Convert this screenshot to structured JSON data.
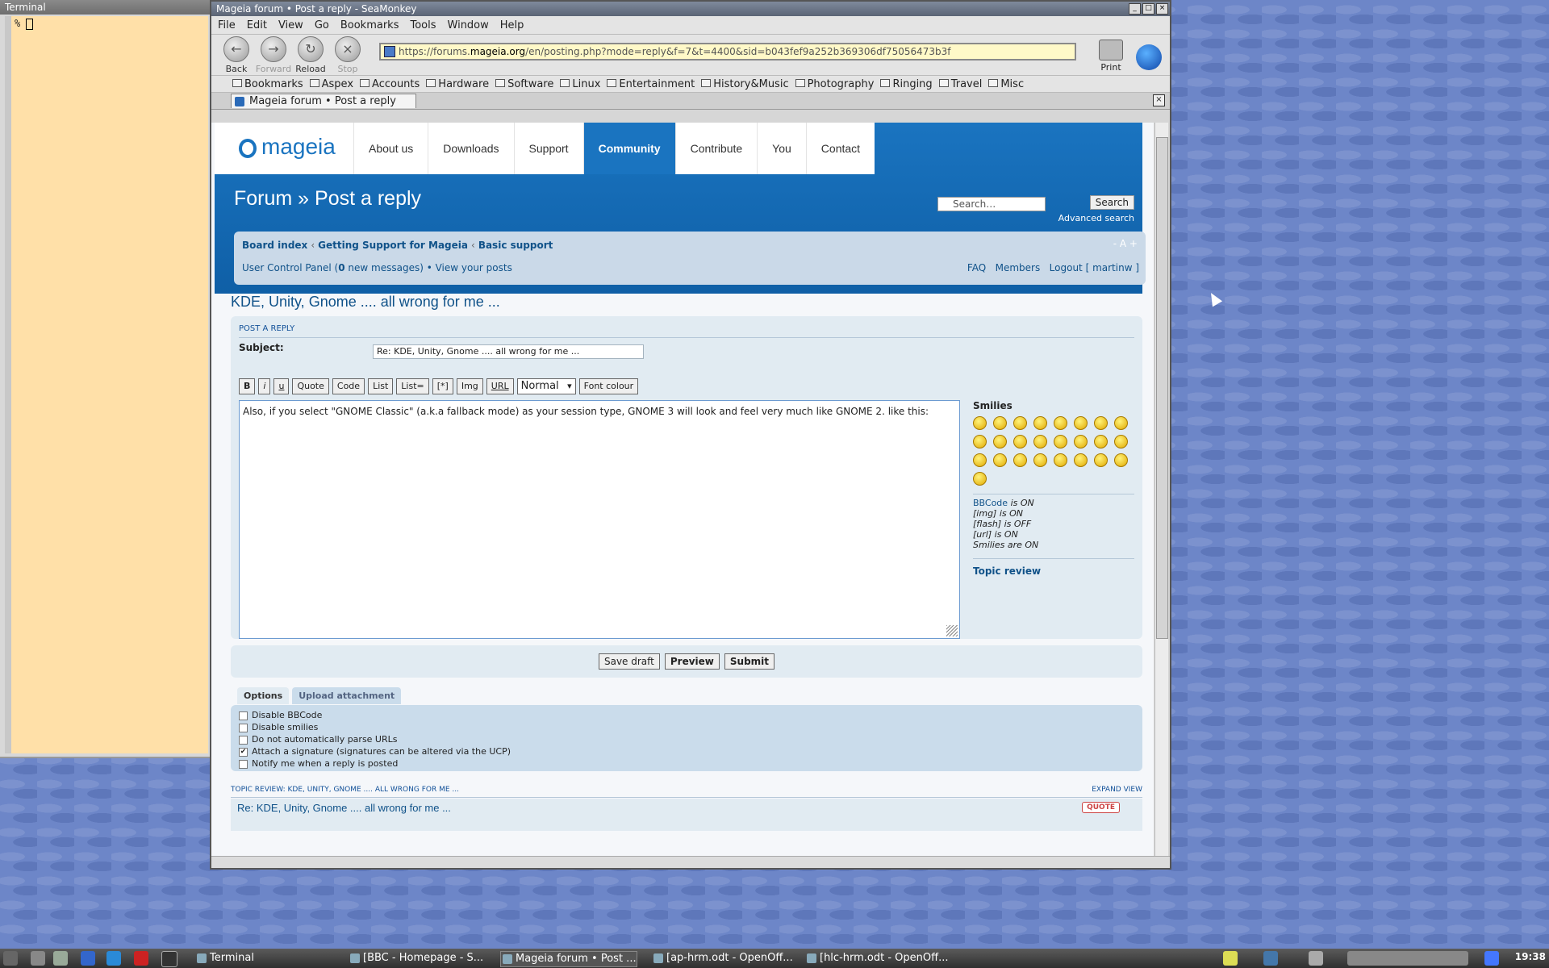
{
  "terminal": {
    "title": "Terminal",
    "prompt": "%"
  },
  "window": {
    "title": "Mageia forum • Post a reply - SeaMonkey"
  },
  "menubar": [
    "File",
    "Edit",
    "View",
    "Go",
    "Bookmarks",
    "Tools",
    "Window",
    "Help"
  ],
  "nav": {
    "back": "Back",
    "forward": "Forward",
    "reload": "Reload",
    "stop": "Stop",
    "print": "Print"
  },
  "url": {
    "prefix": "https://forums.",
    "domain": "mageia.org",
    "suffix": "/en/posting.php?mode=reply&f=7&t=4400&sid=b043fef9a252b369306df75056473b3f"
  },
  "bookmarks": [
    "Bookmarks",
    "Aspex",
    "Accounts",
    "Hardware",
    "Software",
    "Linux",
    "Entertainment",
    "History&Music",
    "Photography",
    "Ringing",
    "Travel",
    "Misc"
  ],
  "tab": {
    "label": "Mageia forum • Post a reply"
  },
  "site": {
    "logo_text": "mageia",
    "nav": [
      "About us",
      "Downloads",
      "Support",
      "Community",
      "Contribute",
      "You",
      "Contact"
    ],
    "active_nav": "Community",
    "heading": "Forum » Post a reply",
    "search_placeholder": "Search…",
    "search_button": "Search",
    "advanced_search": "Advanced search",
    "font_size": "- A +"
  },
  "breadcrumbs": {
    "board_index": "Board index",
    "getting_support": "Getting Support for Mageia",
    "basic_support": "Basic support"
  },
  "userbar": {
    "ucp": "User Control Panel (",
    "new_count": "0",
    "new_messages": " new messages) • View your posts",
    "faq": "FAQ",
    "members": "Members",
    "logout": "Logout [ martinw ]"
  },
  "topic_title": "KDE, Unity, Gnome .... all wrong for me ...",
  "post": {
    "panel_title": "Post a reply",
    "subject_label": "Subject:",
    "subject_value": "Re: KDE, Unity, Gnome .... all wrong for me ...",
    "message": "Also, if you select \"GNOME Classic\" (a.k.a fallback mode) as your session type, GNOME 3 will look and feel very much like GNOME 2. like this:"
  },
  "bbcode_buttons": [
    "B",
    "i",
    "u",
    "Quote",
    "Code",
    "List",
    "List=",
    "[*]",
    "Img",
    "URL"
  ],
  "font_size_select": "Normal",
  "font_colour": "Font colour",
  "smilies": {
    "heading": "Smilies",
    "count": 25,
    "bbcode_label": "BBCode",
    "bbcode_state": "is ON",
    "img": "[img] is ON",
    "flash": "[flash] is OFF",
    "url": "[url] is ON",
    "smilies": "Smilies are ON",
    "topic_review": "Topic review"
  },
  "actions": {
    "save_draft": "Save draft",
    "preview": "Preview",
    "submit": "Submit"
  },
  "option_tabs": [
    "Options",
    "Upload attachment"
  ],
  "options": [
    {
      "label": "Disable BBCode",
      "checked": false
    },
    {
      "label": "Disable smilies",
      "checked": false
    },
    {
      "label": "Do not automatically parse URLs",
      "checked": false
    },
    {
      "label": "Attach a signature (signatures can be altered via the UCP)",
      "checked": true
    },
    {
      "label": "Notify me when a reply is posted",
      "checked": false
    }
  ],
  "topic_review": {
    "line": "TOPIC REVIEW: KDE, UNITY, GNOME .... ALL WRONG FOR ME ...",
    "expand": "EXPAND VIEW",
    "post_title": "Re: KDE, Unity, Gnome .... all wrong for me ...",
    "quote": "QUOTE"
  },
  "taskbar": {
    "items": [
      "Terminal",
      "[BBC - Homepage - S...",
      "Mageia forum • Post ...",
      "[ap-hrm.odt - OpenOff...",
      "[hlc-hrm.odt - OpenOff..."
    ],
    "clock": "19:38"
  },
  "colors": {
    "brand": "#1a74c0",
    "panel": "#e1ebf2",
    "link": "#105289",
    "desktop": "#6d86c8"
  }
}
